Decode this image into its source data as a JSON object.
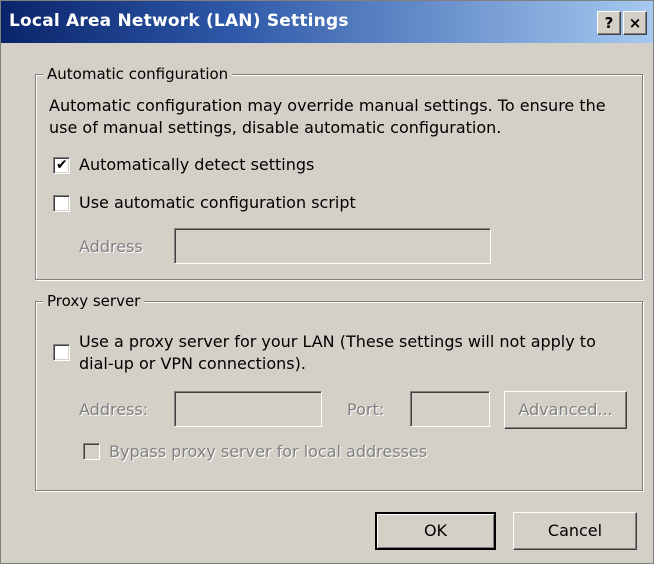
{
  "window": {
    "title": "Local Area Network (LAN) Settings",
    "help_button": "?",
    "close_button": "×"
  },
  "auto_config": {
    "group_label": "Automatic configuration",
    "description_line1": "Automatic configuration may override manual settings.  To ensure the",
    "description_line2": "use of manual settings, disable automatic configuration.",
    "auto_detect_label": "Automatically detect settings",
    "auto_detect_checked": true,
    "script_label": "Use automatic configuration script",
    "script_checked": false,
    "address_label": "Address",
    "address_value": ""
  },
  "proxy": {
    "group_label": "Proxy server",
    "use_proxy_line1": "Use a proxy server for your LAN (These settings will not apply to",
    "use_proxy_line2": "dial-up or VPN connections).",
    "use_proxy_checked": false,
    "address_label": "Address:",
    "address_value": "",
    "port_label": "Port:",
    "port_value": "",
    "advanced_label": "Advanced...",
    "bypass_label": "Bypass proxy server for local addresses",
    "bypass_checked": false
  },
  "buttons": {
    "ok": "OK",
    "cancel": "Cancel"
  },
  "icons": {
    "check": "✔"
  }
}
